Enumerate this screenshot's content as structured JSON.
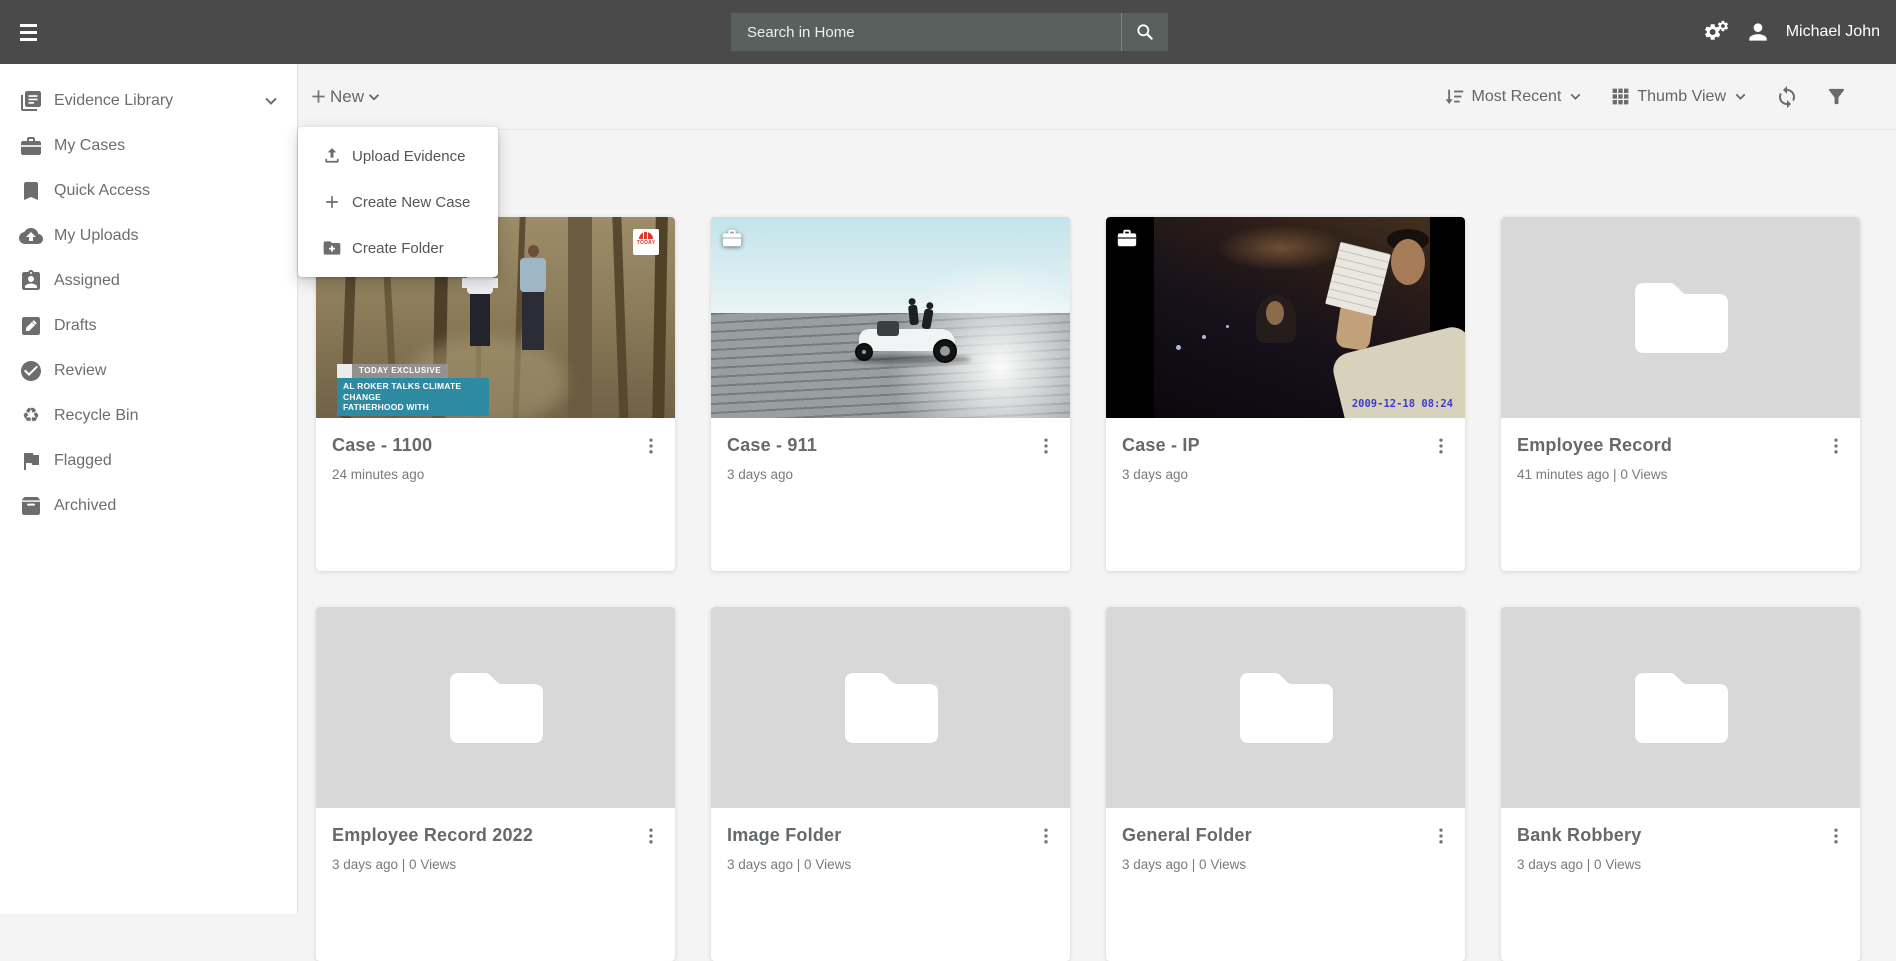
{
  "topbar": {
    "search_placeholder": "Search in Home",
    "user_name": "Michael John"
  },
  "sidebar": {
    "items": [
      {
        "label": "Evidence Library",
        "icon": "library-icon",
        "expanded_arrow": true
      },
      {
        "label": "My Cases",
        "icon": "briefcase-icon"
      },
      {
        "label": "Quick Access",
        "icon": "bookmark-icon"
      },
      {
        "label": "My Uploads",
        "icon": "cloud-upload-icon"
      },
      {
        "label": "Assigned",
        "icon": "assignment-badge-icon"
      },
      {
        "label": "Drafts",
        "icon": "draft-edit-icon"
      },
      {
        "label": "Review",
        "icon": "check-circle-icon"
      },
      {
        "label": "Recycle Bin",
        "icon": "recycle-icon",
        "glyph": "♻"
      },
      {
        "label": "Flagged",
        "icon": "flag-icon"
      },
      {
        "label": "Archived",
        "icon": "archive-icon"
      }
    ]
  },
  "toolbar": {
    "new_label": "New",
    "sort_label": "Most Recent",
    "view_label": "Thumb View"
  },
  "new_menu": {
    "items": [
      {
        "label": "Upload Evidence",
        "icon": "upload-icon"
      },
      {
        "label": "Create New Case",
        "icon": "plus-icon"
      },
      {
        "label": "Create Folder",
        "icon": "folder-plus-icon"
      }
    ]
  },
  "cards": [
    {
      "title": "Case - 1100",
      "meta": "24 minutes ago",
      "type": "video",
      "overlay": {
        "logo": "TODAY",
        "tag": "TODAY EXCLUSIVE",
        "caption_line1": "AL ROKER TALKS CLIMATE CHANGE",
        "caption_line2": "FATHERHOOD WITH"
      }
    },
    {
      "title": "Case - 911",
      "meta": "3 days ago",
      "type": "video",
      "badge": "case-briefcase"
    },
    {
      "title": "Case - IP",
      "meta": "3 days ago",
      "type": "video",
      "badge": "case-briefcase",
      "overlay": {
        "timestamp": "2009-12-18 08:24"
      }
    },
    {
      "title": "Employee Record",
      "meta": "41 minutes ago | 0 Views",
      "type": "folder"
    },
    {
      "title": "Employee Record 2022",
      "meta": "3 days ago | 0 Views",
      "type": "folder"
    },
    {
      "title": "Image Folder",
      "meta": "3 days ago | 0 Views",
      "type": "folder"
    },
    {
      "title": "General Folder",
      "meta": "3 days ago | 0 Views",
      "type": "folder"
    },
    {
      "title": "Bank Robbery",
      "meta": "3 days ago | 0 Views",
      "type": "folder"
    }
  ],
  "colors": {
    "topbar": "#4a4a4a",
    "searchbox": "#59615e",
    "content_bg": "#f4f4f4",
    "folder_thumb_bg": "#d8d8d8",
    "caption_teal": "#2e8aa0",
    "today_red": "#e0352b",
    "timestamp_blue": "#3c3ccc"
  }
}
